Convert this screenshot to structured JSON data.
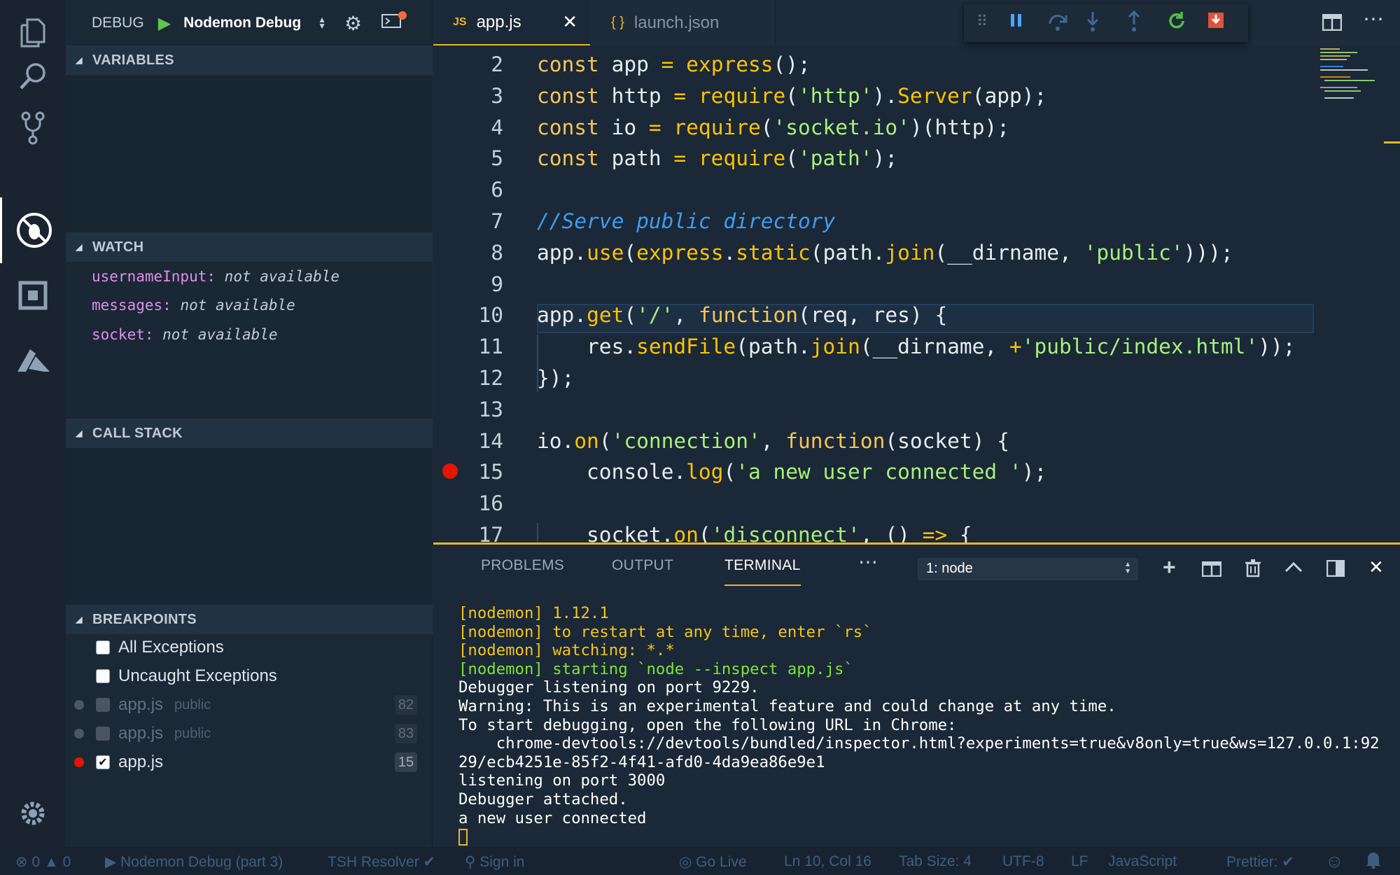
{
  "debug_bar": {
    "label": "DEBUG",
    "config": "Nodemon Debug"
  },
  "sections": {
    "variables": "VARIABLES",
    "watch": "WATCH",
    "call_stack": "CALL STACK",
    "breakpoints": "BREAKPOINTS"
  },
  "watch": [
    {
      "name": "usernameInput",
      "value": "not available"
    },
    {
      "name": "messages",
      "value": "not available"
    },
    {
      "name": "socket",
      "value": "not available"
    }
  ],
  "breakpoints": [
    {
      "label": "All Exceptions",
      "checked": false
    },
    {
      "label": "Uncaught Exceptions",
      "checked": false
    },
    {
      "label": "app.js",
      "folder": "public",
      "line": "82",
      "checked": false
    },
    {
      "label": "app.js",
      "folder": "public",
      "line": "83",
      "checked": false
    },
    {
      "label": "app.js",
      "folder": "",
      "line": "15",
      "checked": true
    }
  ],
  "tabs": [
    {
      "label": "app.js",
      "icon": "JS",
      "active": true
    },
    {
      "label": "launch.json",
      "icon": "{ }",
      "active": false
    }
  ],
  "code_lines": [
    {
      "n": "2",
      "text": "const app = express();"
    },
    {
      "n": "3",
      "text": "const http = require('http').Server(app);"
    },
    {
      "n": "4",
      "text": "const io = require('socket.io')(http);"
    },
    {
      "n": "5",
      "text": "const path = require('path');"
    },
    {
      "n": "6",
      "text": ""
    },
    {
      "n": "7",
      "text": "//Serve public directory"
    },
    {
      "n": "8",
      "text": "app.use(express.static(path.join(__dirname, 'public')));"
    },
    {
      "n": "9",
      "text": ""
    },
    {
      "n": "10",
      "text": "app.get('/', function(req, res) {"
    },
    {
      "n": "11",
      "text": "    res.sendFile(path.join(__dirname, +'public/index.html'));"
    },
    {
      "n": "12",
      "text": "});"
    },
    {
      "n": "13",
      "text": ""
    },
    {
      "n": "14",
      "text": "io.on('connection', function(socket) {"
    },
    {
      "n": "15",
      "text": "    console.log('a new user connected ');"
    },
    {
      "n": "16",
      "text": ""
    },
    {
      "n": "17",
      "text": "    socket.on('disconnect', () => {"
    }
  ],
  "panel": {
    "tabs": [
      "PROBLEMS",
      "OUTPUT",
      "TERMINAL"
    ],
    "terminal_select": "1: node"
  },
  "terminal_lines": [
    {
      "text": "[nodemon] 1.12.1",
      "color": "#f5c518"
    },
    {
      "text": "[nodemon] to restart at any time, enter `rs`",
      "color": "#f5c518"
    },
    {
      "text": "[nodemon] watching: *.*",
      "color": "#f5c518"
    },
    {
      "text": "[nodemon] starting `node --inspect app.js`",
      "color": "#7fe338"
    },
    {
      "text": "Debugger listening on port 9229.",
      "color": "#ffffff"
    },
    {
      "text": "Warning: This is an experimental feature and could change at any time.",
      "color": "#ffffff"
    },
    {
      "text": "To start debugging, open the following URL in Chrome:",
      "color": "#ffffff"
    },
    {
      "text": "    chrome-devtools://devtools/bundled/inspector.html?experiments=true&v8only=true&ws=127.0.0.1:92",
      "color": "#ffffff"
    },
    {
      "text": "29/ecb4251e-85f2-4f41-afd0-4da9ea86e9e1",
      "color": "#ffffff"
    },
    {
      "text": "listening on port 3000",
      "color": "#ffffff"
    },
    {
      "text": "Debugger attached.",
      "color": "#ffffff"
    },
    {
      "text": "a new user connected",
      "color": "#ffffff"
    }
  ],
  "status": {
    "errors": "0",
    "warnings": "0",
    "debug_config": "Nodemon Debug (part 3)",
    "tsh": "TSH Resolver ✔",
    "sign_in": "Sign in",
    "go_live": "Go Live",
    "position": "Ln 10, Col 16",
    "tab_size": "Tab Size: 4",
    "encoding": "UTF-8",
    "eol": "LF",
    "language": "JavaScript",
    "prettier": "Prettier: ✔"
  },
  "colors": {
    "accent": "#e7b725",
    "breakpoint": "#e51400",
    "activity_bg": "#1a2430",
    "sidebar_bg": "#1b2836"
  }
}
